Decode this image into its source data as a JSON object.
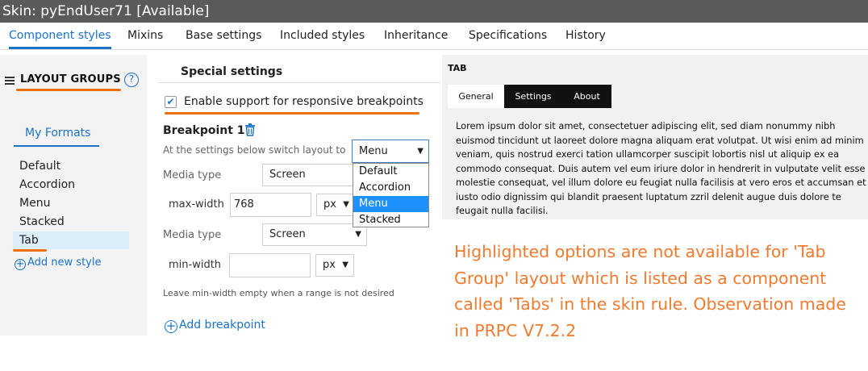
{
  "window": {
    "title": "Skin: pyEndUser71 [Available]"
  },
  "tabs": [
    {
      "label": "Component styles",
      "active": true
    },
    {
      "label": "Mixins"
    },
    {
      "label": "Base settings"
    },
    {
      "label": "Included styles"
    },
    {
      "label": "Inheritance"
    },
    {
      "label": "Specifications"
    },
    {
      "label": "History"
    }
  ],
  "sidebar": {
    "heading": "LAYOUT GROUPS",
    "help_glyph": "?",
    "formats_tab": "My Formats",
    "items": [
      "Default",
      "Accordion",
      "Menu",
      "Stacked",
      "Tab"
    ],
    "selected": "Tab",
    "add_label": "Add new style",
    "highlight_color": "#f07010"
  },
  "settings": {
    "section_title": "Special settings",
    "responsive_checkbox": {
      "label": "Enable support for responsive breakpoints",
      "checked": true,
      "check_glyph": "✔"
    },
    "breakpoint_title": "Breakpoint 1",
    "switch_label": "At the settings below switch layout to",
    "switch_value": "Menu",
    "switch_options": [
      "Default",
      "Accordion",
      "Menu",
      "Stacked"
    ],
    "media_type_label": "Media type",
    "media_type_value": "Screen",
    "max_width_label": "max-width",
    "max_width_value": "768",
    "min_width_label": "min-width",
    "min_width_value": "",
    "unit_value": "px",
    "hint": "Leave min-width empty when a range is not desired",
    "add_breakpoint": "Add breakpoint",
    "caret_glyph": "▼",
    "plus_glyph": "+"
  },
  "preview": {
    "label": "TAB",
    "tabs": [
      "General",
      "Settings",
      "About"
    ],
    "active_tab": "General",
    "body": "Lorem ipsum dolor sit amet, consectetuer adipiscing elit, sed diam nonummy nibh euismod tincidunt ut laoreet dolore magna aliquam erat volutpat. Ut wisi enim ad minim veniam, quis nostrud exerci tation ullamcorper suscipit lobortis nisl ut aliquip ex ea commodo consequat. Duis autem vel eum iriure dolor in hendrerit in vulputate velit esse molestie consequat, vel illum dolore eu feugiat nulla facilisis at vero eros et accumsan et iusto odio dignissim qui blandit praesent luptatum zzril delenit augue duis dolore te feugait nulla facilisi."
  },
  "annotation": {
    "text": "Highlighted options are not available for 'Tab Group' layout which is listed as a component called 'Tabs' in the skin rule. Observation made in PRPC V7.2.2",
    "color": "#f07a2e"
  }
}
